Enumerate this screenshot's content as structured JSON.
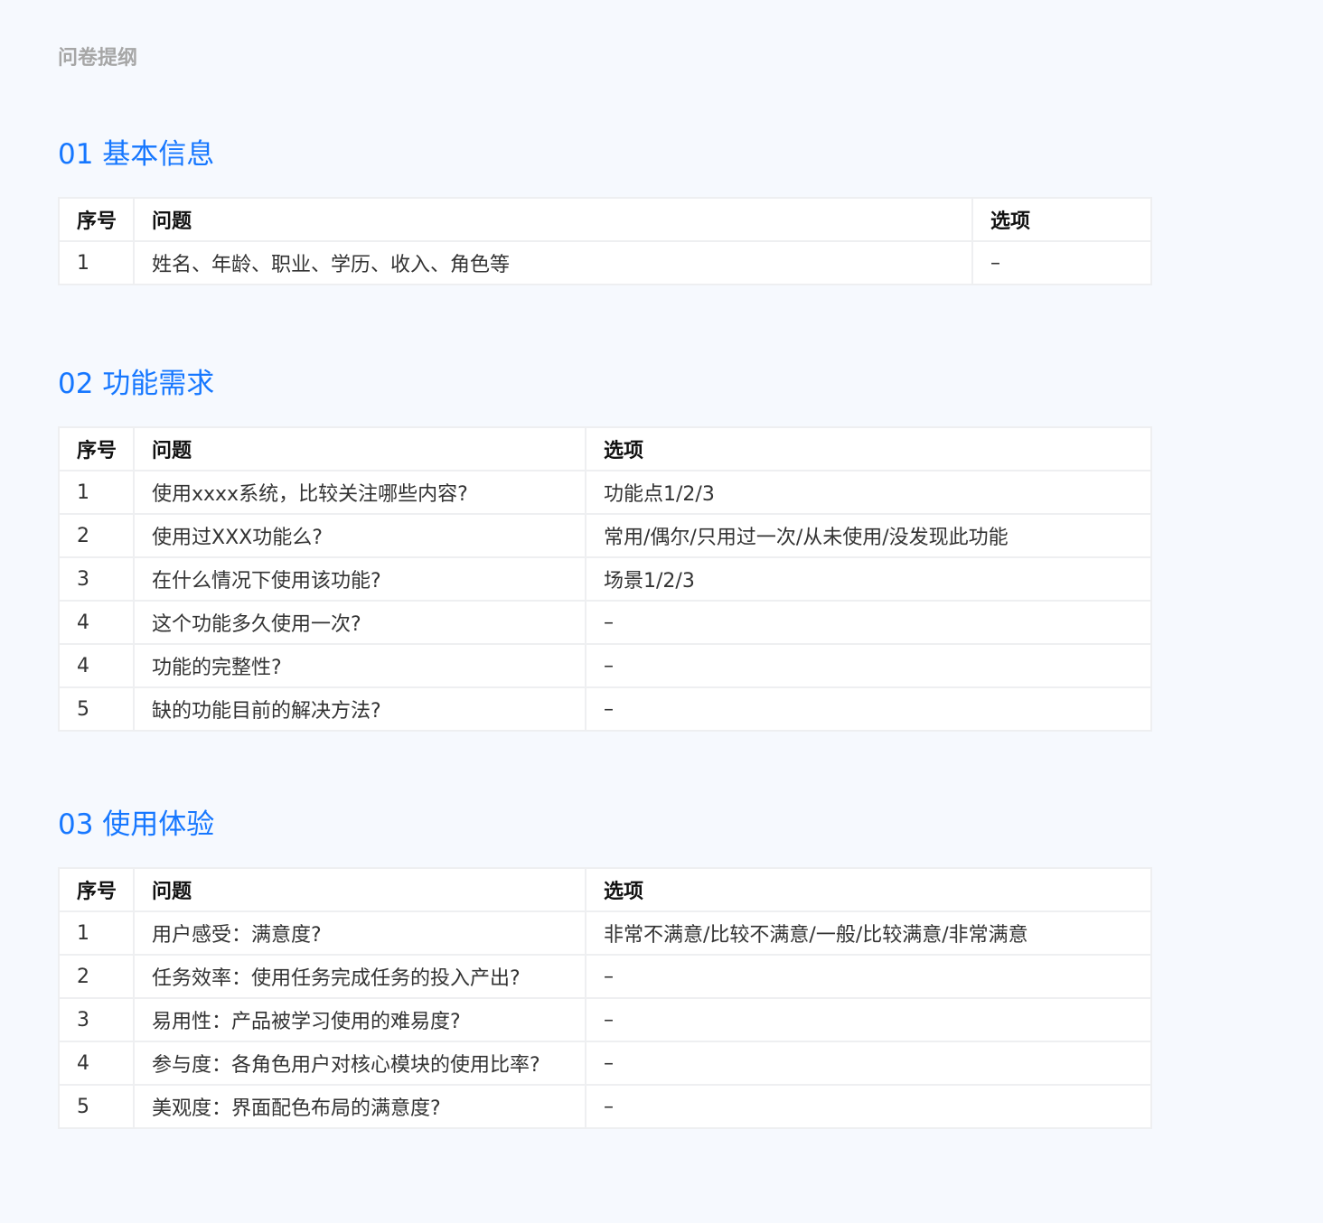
{
  "page_title": "问卷提纲",
  "headers": {
    "num": "序号",
    "question": "问题",
    "options": "选项"
  },
  "sections": [
    {
      "title": "01 基本信息",
      "rows": [
        {
          "num": "1",
          "question": "姓名、年龄、职业、学历、收入、角色等",
          "options": "–"
        }
      ]
    },
    {
      "title": "02 功能需求",
      "rows": [
        {
          "num": "1",
          "question": "使用xxxx系统，比较关注哪些内容?",
          "options": "功能点1/2/3"
        },
        {
          "num": "2",
          "question": "使用过XXX功能么?",
          "options": "常用/偶尔/只用过一次/从未使用/没发现此功能"
        },
        {
          "num": "3",
          "question": "在什么情况下使用该功能?",
          "options": "场景1/2/3"
        },
        {
          "num": "4",
          "question": "这个功能多久使用一次?",
          "options": "–"
        },
        {
          "num": "4",
          "question": "功能的完整性?",
          "options": "–"
        },
        {
          "num": "5",
          "question": "缺的功能目前的解决方法?",
          "options": "–"
        }
      ]
    },
    {
      "title": "03 使用体验",
      "rows": [
        {
          "num": "1",
          "question": "用户感受：满意度?",
          "options": "非常不满意/比较不满意/一般/比较满意/非常满意"
        },
        {
          "num": "2",
          "question": "任务效率：使用任务完成任务的投入产出?",
          "options": "–"
        },
        {
          "num": "3",
          "question": "易用性：产品被学习使用的难易度?",
          "options": "–"
        },
        {
          "num": "4",
          "question": "参与度：各角色用户对核心模块的使用比率?",
          "options": "–"
        },
        {
          "num": "5",
          "question": "美观度：界面配色布局的满意度?",
          "options": "–"
        }
      ]
    }
  ]
}
